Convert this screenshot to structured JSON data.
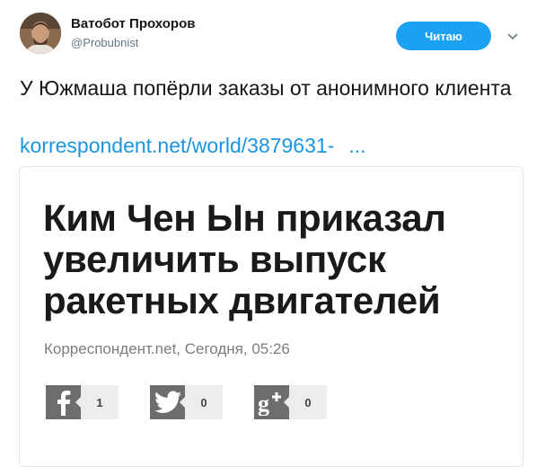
{
  "user": {
    "display_name": "Ватобот Прохоров",
    "handle": "@Probubnist"
  },
  "follow_button": {
    "label": "Читаю"
  },
  "tweet": {
    "text": "У Южмаша попёрли заказы от анонимного клиента",
    "link_text": "korrespondent.net/world/3879631-",
    "link_ellipsis": "..."
  },
  "card": {
    "title": "Ким Чен Ын приказал увеличить выпуск ракетных двигателей",
    "meta": "Корреспондент.net, Сегодня, 05:26",
    "shares": [
      {
        "network": "facebook",
        "icon": "facebook-icon",
        "count": "1"
      },
      {
        "network": "twitter",
        "icon": "twitter-icon",
        "count": "0"
      },
      {
        "network": "google-plus",
        "icon": "google-plus-icon",
        "count": "0"
      }
    ]
  },
  "colors": {
    "accent": "#1da1f2",
    "link": "#1b95e0",
    "share_icon_bg": "#6d6d6d",
    "share_count_bg": "#ededed"
  }
}
